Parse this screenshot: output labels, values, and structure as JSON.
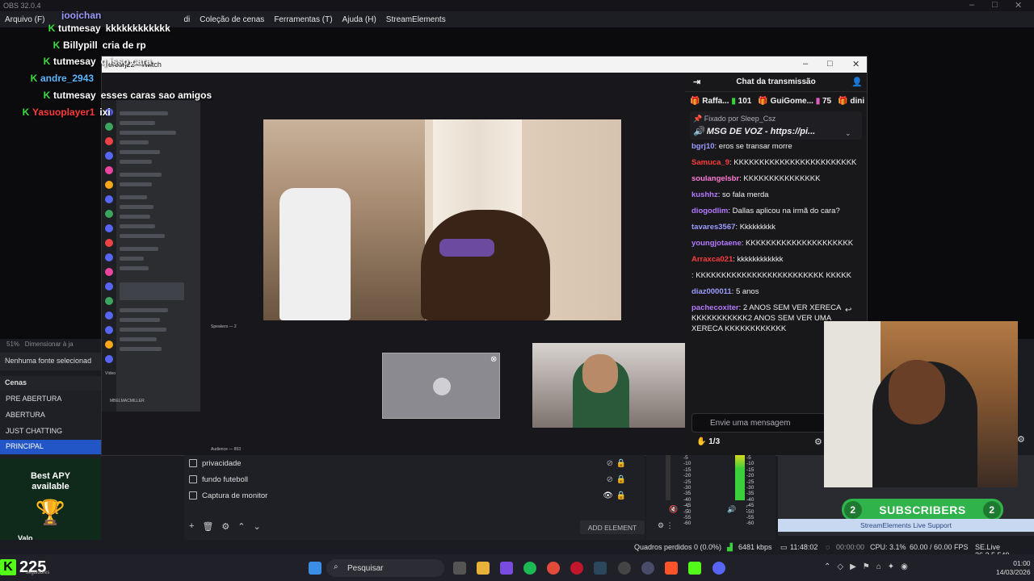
{
  "obs": {
    "title": "OBS 32.0.4",
    "menu": [
      "Arquivo (F)",
      "di",
      "Coleção de cenas",
      "Ferramentas (T)",
      "Ajuda (H)",
      "StreamElements"
    ],
    "zoom": "51%",
    "zoom_mode": "Dimensionar à ja",
    "no_source": "Nenhuma fonte selecionad",
    "scenes_header": "Cenas",
    "scenes": [
      "PRE ABERTURA",
      "ABERTURA",
      "JUST CHATTING",
      "PRINCIPAL"
    ],
    "sources": [
      "privacidade",
      "fundo futeboll",
      "Captura de monitor"
    ],
    "add_element": "ADD ELEMENT",
    "db_scale": [
      "-5",
      "-10",
      "-15",
      "-20",
      "-25",
      "-30",
      "-35",
      "-40",
      "-45",
      "-50",
      "-55",
      "-60"
    ],
    "status": {
      "dropped": "Quadros perdidos 0 (0.0%)",
      "bitrate": "6481 kbps",
      "rec_time": "11:48:02",
      "stream_time": "00:00:00",
      "cpu": "CPU: 3.1%",
      "fps": "60.00 / 60.00 FPS",
      "se_version": "SE.Live 26.2.5.549"
    }
  },
  "overlay_chat": [
    {
      "user": "joojchan",
      "text": ""
    },
    {
      "user": "tutmesay",
      "text": "kkkkkkkkkkkk"
    },
    {
      "user": "Billypill",
      "text": "cria de rp"
    },
    {
      "user": "tutmesay",
      "text": "q isso cara"
    },
    {
      "user": "andre_2943",
      "text": ""
    },
    {
      "user": "tutmesay",
      "text": "esses caras sao amigos"
    },
    {
      "user": "Yasuoplayer1",
      "text": "ixi"
    }
  ],
  "twitch": {
    "window_title": "erosrj22 - Twitch",
    "chat_title": "Chat da transmissão",
    "gifts": [
      {
        "user": "Raffa...",
        "count": "101"
      },
      {
        "user": "GuiGome...",
        "count": "75"
      },
      {
        "user": "dini",
        "count": ""
      }
    ],
    "pinned_by": "Fixado por",
    "pinned_user": "Sleep_Csz",
    "pinned_msg": "MSG DE VOZ - https://pi...",
    "messages": [
      {
        "user": "bgrj10",
        "color": "#9c9cff",
        "text": "eros se transar morre"
      },
      {
        "user": "Samuca_9",
        "color": "#ff3b3b",
        "text": "KKKKKKKKKKKKKKKKKKKKKKKK"
      },
      {
        "user": "soulangelsbr",
        "color": "#ff7bd5",
        "text": "KKKKKKKKKKKKKKK"
      },
      {
        "user": "kushhz",
        "color": "#b479ff",
        "text": "so fala merda"
      },
      {
        "user": "diogodlim",
        "color": "#b479ff",
        "text": "Dallas aplicou na irmã do cara?"
      },
      {
        "user": "tavares3567",
        "color": "#9c9cff",
        "text": "Kkkkkkkkk"
      },
      {
        "user": "youngjotaene",
        "color": "#b479ff",
        "text": "KKKKKKKKKKKKKKKKKKKKK"
      },
      {
        "user": "Arraxca021",
        "color": "#ff3b3b",
        "text": "kkkkkkkkkkkk"
      },
      {
        "user": "",
        "color": "#ff3b3b",
        "text": "KKKKKKKKKKKKKKKKKKKKKKKKK KKKKK"
      },
      {
        "user": "diaz000011",
        "color": "#9c9cff",
        "text": "5 anos"
      },
      {
        "user": "pachecoxiter",
        "color": "#b479ff",
        "text": "2 ANOS SEM VER XERECA KKKKKKKKKKK2 ANOS SEM VER UMA XERECA KKKKKKKKKKKK"
      }
    ],
    "input_placeholder": "Envie uma mensagem",
    "points": "1/3",
    "inner_user": "MBELMACMILLER",
    "inner_audience": "Audience — 893",
    "inner_speakers": "Speakers — 2",
    "inner_video": "Vídeo"
  },
  "banner": {
    "subs_left": "2",
    "subs_label": "SUBSCRIBERS",
    "subs_right": "2",
    "se_support": "StreamElements Live Support"
  },
  "ad": {
    "line1": "Best APY",
    "line2": "available",
    "brand": "Valo"
  },
  "kick": {
    "viewers": "225",
    "sub": "seguidores"
  },
  "taskbar": {
    "search": "Pesquisar",
    "time": "01:00",
    "date": "14/03/2026"
  }
}
